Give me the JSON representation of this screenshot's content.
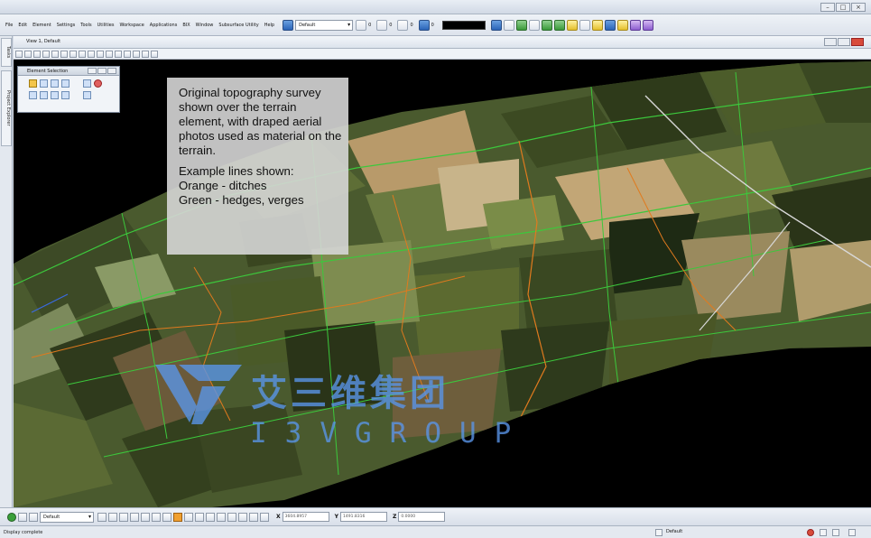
{
  "menu": [
    "File",
    "Edit",
    "Element",
    "Settings",
    "Tools",
    "Utilities",
    "Workspace",
    "Applications",
    "BIX",
    "Window",
    "Subsurface Utility",
    "Help"
  ],
  "toolbar": {
    "level_value": "Default",
    "numeric_values": [
      "0",
      "0",
      "0",
      "0"
    ]
  },
  "side_tabs": [
    "Tasks",
    "Project Explorer"
  ],
  "view": {
    "title": "View 1, Default"
  },
  "element_selection": {
    "title": "Element Selection"
  },
  "callout": {
    "paragraph1": "Original topography survey shown over the terrain element, with draped aerial photos used as material on the terrain.",
    "line1": "Example lines shown:",
    "line2": "Orange - ditches",
    "line3": "Green - hedges, verges"
  },
  "watermark": {
    "cn": "艾三维集团",
    "en": "I3VGROUP"
  },
  "coords": {
    "level_value": "Default",
    "x_label": "X",
    "x_value": "3604.8957",
    "y_label": "Y",
    "y_value": "1491.8316",
    "z_label": "Z",
    "z_value": "0.0000"
  },
  "status": {
    "message": "Display complete",
    "model": "Default"
  },
  "colors": {
    "ditch": "#e07a1e",
    "hedge": "#3cc83c",
    "accent": "#2a64b8"
  }
}
